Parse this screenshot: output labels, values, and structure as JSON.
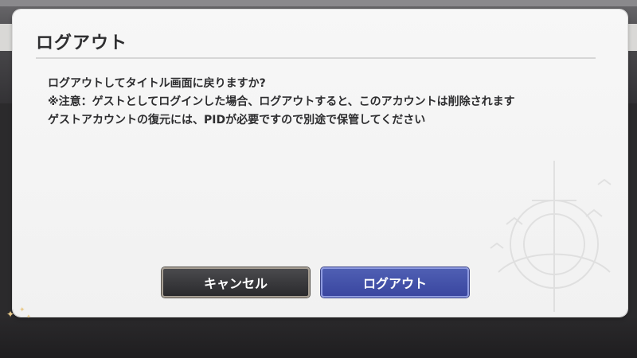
{
  "dialog": {
    "title": "ログアウト",
    "message_lines": [
      "ログアウトしてタイトル画面に戻りますか?",
      "※注意：ゲストとしてログインした場合、ログアウトすると、このアカウントは削除されます",
      "ゲストアカウントの復元には、PIDが必要ですので別途で保管してください"
    ],
    "cancel_label": "キャンセル",
    "logout_label": "ログアウト"
  },
  "colors": {
    "logout_button": "#3f4ca8",
    "cancel_button": "#36363a",
    "dialog_bg": "#f4f4f4"
  }
}
